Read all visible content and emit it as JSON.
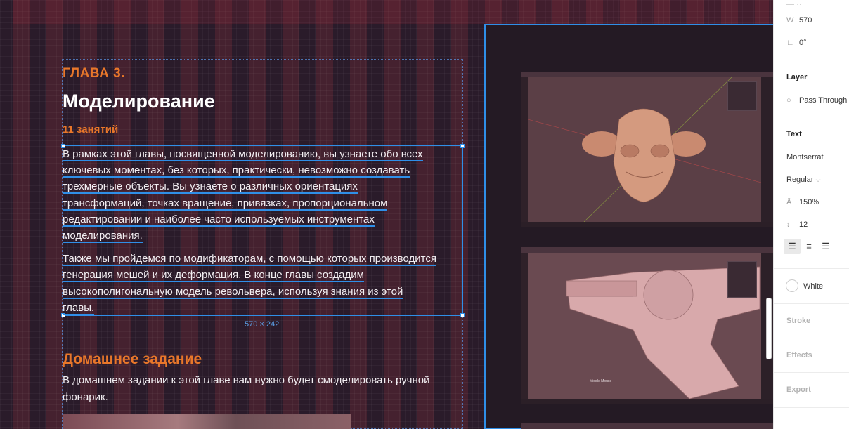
{
  "canvas": {
    "chapter_label": "ГЛАВА 3.",
    "chapter_title": "Моделирование",
    "lessons_count": "11 занятий",
    "description": {
      "p1": [
        "В рамках этой главы, посвященной моделированию, вы узнаете обо всех",
        "ключевых моментах, без которых, практически, невозможно создавать",
        "трехмерные объекты. Вы узнаете о различных ориентациях",
        "трансформаций, точках вращение, привязках, пропорциональном",
        "редактировании и наиболее часто используемых инструментах",
        "моделирования."
      ],
      "p2": [
        "Также мы пройдемся по модификаторам, с помощью которых производится",
        "генерация мешей и их деформация. В конце главы создадим",
        "высокополигональную модель револьвера, используя знания из этой",
        "главы."
      ]
    },
    "selection_size": "570 × 242",
    "homework_title": "Домашнее задание",
    "homework_body": "В домашнем задании к этой главе вам нужно будет смоделировать ручной фонарик.",
    "screenshot_caption": "Middle Mouse"
  },
  "properties": {
    "w_label": "W",
    "w_value": "570",
    "rotation_value": "0°",
    "layer_header": "Layer",
    "blend_mode": "Pass Through",
    "text_header": "Text",
    "font_family": "Montserrat",
    "font_weight": "Regular",
    "line_height": "150%",
    "paragraph_spacing": "12",
    "fill_name": "White",
    "stroke_header": "Stroke",
    "effects_header": "Effects",
    "export_header": "Export"
  },
  "colors": {
    "accent_orange": "#e8772a",
    "selection_blue": "#2f8fe8"
  }
}
